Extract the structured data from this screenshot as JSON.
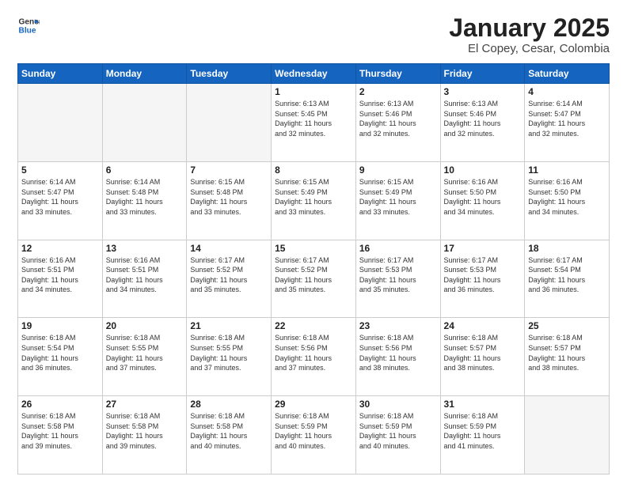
{
  "logo": {
    "line1": "General",
    "line2": "Blue"
  },
  "title": "January 2025",
  "subtitle": "El Copey, Cesar, Colombia",
  "headers": [
    "Sunday",
    "Monday",
    "Tuesday",
    "Wednesday",
    "Thursday",
    "Friday",
    "Saturday"
  ],
  "weeks": [
    [
      {
        "day": "",
        "info": ""
      },
      {
        "day": "",
        "info": ""
      },
      {
        "day": "",
        "info": ""
      },
      {
        "day": "1",
        "info": "Sunrise: 6:13 AM\nSunset: 5:45 PM\nDaylight: 11 hours\nand 32 minutes."
      },
      {
        "day": "2",
        "info": "Sunrise: 6:13 AM\nSunset: 5:46 PM\nDaylight: 11 hours\nand 32 minutes."
      },
      {
        "day": "3",
        "info": "Sunrise: 6:13 AM\nSunset: 5:46 PM\nDaylight: 11 hours\nand 32 minutes."
      },
      {
        "day": "4",
        "info": "Sunrise: 6:14 AM\nSunset: 5:47 PM\nDaylight: 11 hours\nand 32 minutes."
      }
    ],
    [
      {
        "day": "5",
        "info": "Sunrise: 6:14 AM\nSunset: 5:47 PM\nDaylight: 11 hours\nand 33 minutes."
      },
      {
        "day": "6",
        "info": "Sunrise: 6:14 AM\nSunset: 5:48 PM\nDaylight: 11 hours\nand 33 minutes."
      },
      {
        "day": "7",
        "info": "Sunrise: 6:15 AM\nSunset: 5:48 PM\nDaylight: 11 hours\nand 33 minutes."
      },
      {
        "day": "8",
        "info": "Sunrise: 6:15 AM\nSunset: 5:49 PM\nDaylight: 11 hours\nand 33 minutes."
      },
      {
        "day": "9",
        "info": "Sunrise: 6:15 AM\nSunset: 5:49 PM\nDaylight: 11 hours\nand 33 minutes."
      },
      {
        "day": "10",
        "info": "Sunrise: 6:16 AM\nSunset: 5:50 PM\nDaylight: 11 hours\nand 34 minutes."
      },
      {
        "day": "11",
        "info": "Sunrise: 6:16 AM\nSunset: 5:50 PM\nDaylight: 11 hours\nand 34 minutes."
      }
    ],
    [
      {
        "day": "12",
        "info": "Sunrise: 6:16 AM\nSunset: 5:51 PM\nDaylight: 11 hours\nand 34 minutes."
      },
      {
        "day": "13",
        "info": "Sunrise: 6:16 AM\nSunset: 5:51 PM\nDaylight: 11 hours\nand 34 minutes."
      },
      {
        "day": "14",
        "info": "Sunrise: 6:17 AM\nSunset: 5:52 PM\nDaylight: 11 hours\nand 35 minutes."
      },
      {
        "day": "15",
        "info": "Sunrise: 6:17 AM\nSunset: 5:52 PM\nDaylight: 11 hours\nand 35 minutes."
      },
      {
        "day": "16",
        "info": "Sunrise: 6:17 AM\nSunset: 5:53 PM\nDaylight: 11 hours\nand 35 minutes."
      },
      {
        "day": "17",
        "info": "Sunrise: 6:17 AM\nSunset: 5:53 PM\nDaylight: 11 hours\nand 36 minutes."
      },
      {
        "day": "18",
        "info": "Sunrise: 6:17 AM\nSunset: 5:54 PM\nDaylight: 11 hours\nand 36 minutes."
      }
    ],
    [
      {
        "day": "19",
        "info": "Sunrise: 6:18 AM\nSunset: 5:54 PM\nDaylight: 11 hours\nand 36 minutes."
      },
      {
        "day": "20",
        "info": "Sunrise: 6:18 AM\nSunset: 5:55 PM\nDaylight: 11 hours\nand 37 minutes."
      },
      {
        "day": "21",
        "info": "Sunrise: 6:18 AM\nSunset: 5:55 PM\nDaylight: 11 hours\nand 37 minutes."
      },
      {
        "day": "22",
        "info": "Sunrise: 6:18 AM\nSunset: 5:56 PM\nDaylight: 11 hours\nand 37 minutes."
      },
      {
        "day": "23",
        "info": "Sunrise: 6:18 AM\nSunset: 5:56 PM\nDaylight: 11 hours\nand 38 minutes."
      },
      {
        "day": "24",
        "info": "Sunrise: 6:18 AM\nSunset: 5:57 PM\nDaylight: 11 hours\nand 38 minutes."
      },
      {
        "day": "25",
        "info": "Sunrise: 6:18 AM\nSunset: 5:57 PM\nDaylight: 11 hours\nand 38 minutes."
      }
    ],
    [
      {
        "day": "26",
        "info": "Sunrise: 6:18 AM\nSunset: 5:58 PM\nDaylight: 11 hours\nand 39 minutes."
      },
      {
        "day": "27",
        "info": "Sunrise: 6:18 AM\nSunset: 5:58 PM\nDaylight: 11 hours\nand 39 minutes."
      },
      {
        "day": "28",
        "info": "Sunrise: 6:18 AM\nSunset: 5:58 PM\nDaylight: 11 hours\nand 40 minutes."
      },
      {
        "day": "29",
        "info": "Sunrise: 6:18 AM\nSunset: 5:59 PM\nDaylight: 11 hours\nand 40 minutes."
      },
      {
        "day": "30",
        "info": "Sunrise: 6:18 AM\nSunset: 5:59 PM\nDaylight: 11 hours\nand 40 minutes."
      },
      {
        "day": "31",
        "info": "Sunrise: 6:18 AM\nSunset: 5:59 PM\nDaylight: 11 hours\nand 41 minutes."
      },
      {
        "day": "",
        "info": ""
      }
    ]
  ]
}
